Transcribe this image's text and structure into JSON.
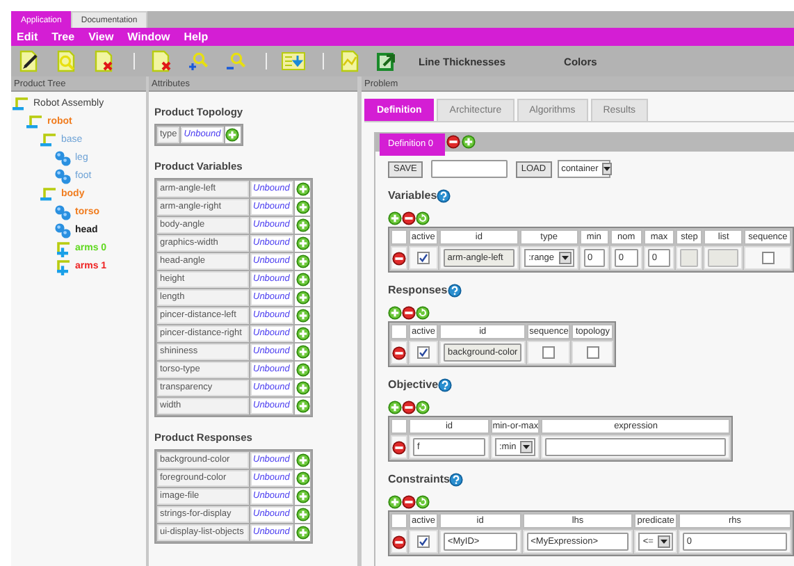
{
  "app_tabs": [
    {
      "label": "Application",
      "selected": true
    },
    {
      "label": "Documentation",
      "selected": false
    }
  ],
  "menu": [
    "Edit",
    "Tree",
    "View",
    "Window",
    "Help"
  ],
  "toolbar": {
    "labels": [
      "Line Thicknesses",
      "Colors"
    ]
  },
  "product_tree": {
    "title": "Product Tree",
    "root": {
      "label": "Robot Assembly",
      "kind": "group",
      "expanded": true,
      "color": "#404040",
      "bold": false,
      "children": [
        {
          "label": "robot",
          "kind": "group",
          "expanded": true,
          "color": "#f07c1e",
          "bold": true,
          "children": [
            {
              "label": "base",
              "kind": "group",
              "expanded": true,
              "color": "#6fa3d6",
              "bold": false,
              "children": [
                {
                  "label": "leg",
                  "kind": "leaf",
                  "color": "#6fa3d6",
                  "bold": false
                },
                {
                  "label": "foot",
                  "kind": "leaf",
                  "color": "#6fa3d6",
                  "bold": false
                }
              ]
            },
            {
              "label": "body",
              "kind": "group",
              "expanded": true,
              "color": "#f07c1e",
              "bold": true,
              "children": [
                {
                  "label": "torso",
                  "kind": "leaf",
                  "color": "#f07c1e",
                  "bold": true
                },
                {
                  "label": "head",
                  "kind": "leaf",
                  "color": "#202020",
                  "bold": true
                },
                {
                  "label": "arms 0",
                  "kind": "group",
                  "expanded": false,
                  "color": "#5fd81e",
                  "bold": true
                },
                {
                  "label": "arms 1",
                  "kind": "group",
                  "expanded": false,
                  "color": "#ee2222",
                  "bold": true
                }
              ]
            }
          ]
        }
      ]
    }
  },
  "attributes": {
    "title": "Attributes",
    "sections": [
      {
        "heading": "Product Topology",
        "kind": "inline",
        "rows": [
          {
            "name": "type",
            "binding": "Unbound"
          }
        ]
      },
      {
        "heading": "Product Variables",
        "kind": "list",
        "rows": [
          {
            "name": "arm-angle-left",
            "binding": "Unbound"
          },
          {
            "name": "arm-angle-right",
            "binding": "Unbound"
          },
          {
            "name": "body-angle",
            "binding": "Unbound"
          },
          {
            "name": "graphics-width",
            "binding": "Unbound"
          },
          {
            "name": "head-angle",
            "binding": "Unbound"
          },
          {
            "name": "height",
            "binding": "Unbound"
          },
          {
            "name": "length",
            "binding": "Unbound"
          },
          {
            "name": "pincer-distance-left",
            "binding": "Unbound"
          },
          {
            "name": "pincer-distance-right",
            "binding": "Unbound"
          },
          {
            "name": "shininess",
            "binding": "Unbound"
          },
          {
            "name": "torso-type",
            "binding": "Unbound"
          },
          {
            "name": "transparency",
            "binding": "Unbound"
          },
          {
            "name": "width",
            "binding": "Unbound"
          }
        ]
      },
      {
        "heading": "Product Responses",
        "kind": "list",
        "rows": [
          {
            "name": "background-color",
            "binding": "Unbound"
          },
          {
            "name": "foreground-color",
            "binding": "Unbound"
          },
          {
            "name": "image-file",
            "binding": "Unbound"
          },
          {
            "name": "strings-for-display",
            "binding": "Unbound"
          },
          {
            "name": "ui-display-list-objects",
            "binding": "Unbound"
          }
        ]
      }
    ]
  },
  "problem": {
    "title": "Problem",
    "tabs": [
      {
        "label": "Definition",
        "selected": true
      },
      {
        "label": "Architecture",
        "selected": false
      },
      {
        "label": "Algorithms",
        "selected": false
      },
      {
        "label": "Results",
        "selected": false
      }
    ],
    "definition_tab": "Definition 0",
    "save_button": "SAVE",
    "load_button": "LOAD",
    "container_select": "container",
    "sections": [
      {
        "heading": "Variables",
        "columns": [
          "active",
          "id",
          "type",
          "min",
          "nom",
          "max",
          "step",
          "list",
          "sequence"
        ],
        "rows": [
          [
            {
              "kind": "check",
              "checked": true
            },
            {
              "kind": "readonly",
              "value": "arm-angle-left"
            },
            {
              "kind": "select",
              "value": ":range"
            },
            {
              "kind": "input",
              "value": "0",
              "disabled": false
            },
            {
              "kind": "input",
              "value": "0",
              "disabled": false
            },
            {
              "kind": "input",
              "value": "0",
              "disabled": false
            },
            {
              "kind": "input",
              "disabled": true
            },
            {
              "kind": "input",
              "disabled": true
            },
            {
              "kind": "check",
              "checked": false
            }
          ]
        ]
      },
      {
        "heading": "Responses",
        "columns": [
          "active",
          "id",
          "sequence",
          "topology"
        ],
        "rows": [
          [
            {
              "kind": "check",
              "checked": true
            },
            {
              "kind": "readonly",
              "value": "background-color"
            },
            {
              "kind": "check",
              "checked": false
            },
            {
              "kind": "check",
              "checked": false
            }
          ]
        ]
      },
      {
        "heading": "Objective",
        "columns": [
          "id",
          "min-or-max",
          "expression"
        ],
        "rows": [
          [
            {
              "kind": "input",
              "value": "f",
              "disabled": false
            },
            {
              "kind": "select",
              "value": ":min"
            },
            {
              "kind": "input",
              "disabled": false
            }
          ]
        ]
      },
      {
        "heading": "Constraints",
        "columns": [
          "active",
          "id",
          "lhs",
          "predicate",
          "rhs"
        ],
        "rows": [
          [
            {
              "kind": "check",
              "checked": true
            },
            {
              "kind": "input",
              "value": "<MyID>",
              "disabled": false
            },
            {
              "kind": "input",
              "value": "<MyExpression>",
              "disabled": false
            },
            {
              "kind": "select",
              "value": "<="
            },
            {
              "kind": "input",
              "value": "0",
              "disabled": false
            }
          ]
        ]
      }
    ]
  }
}
